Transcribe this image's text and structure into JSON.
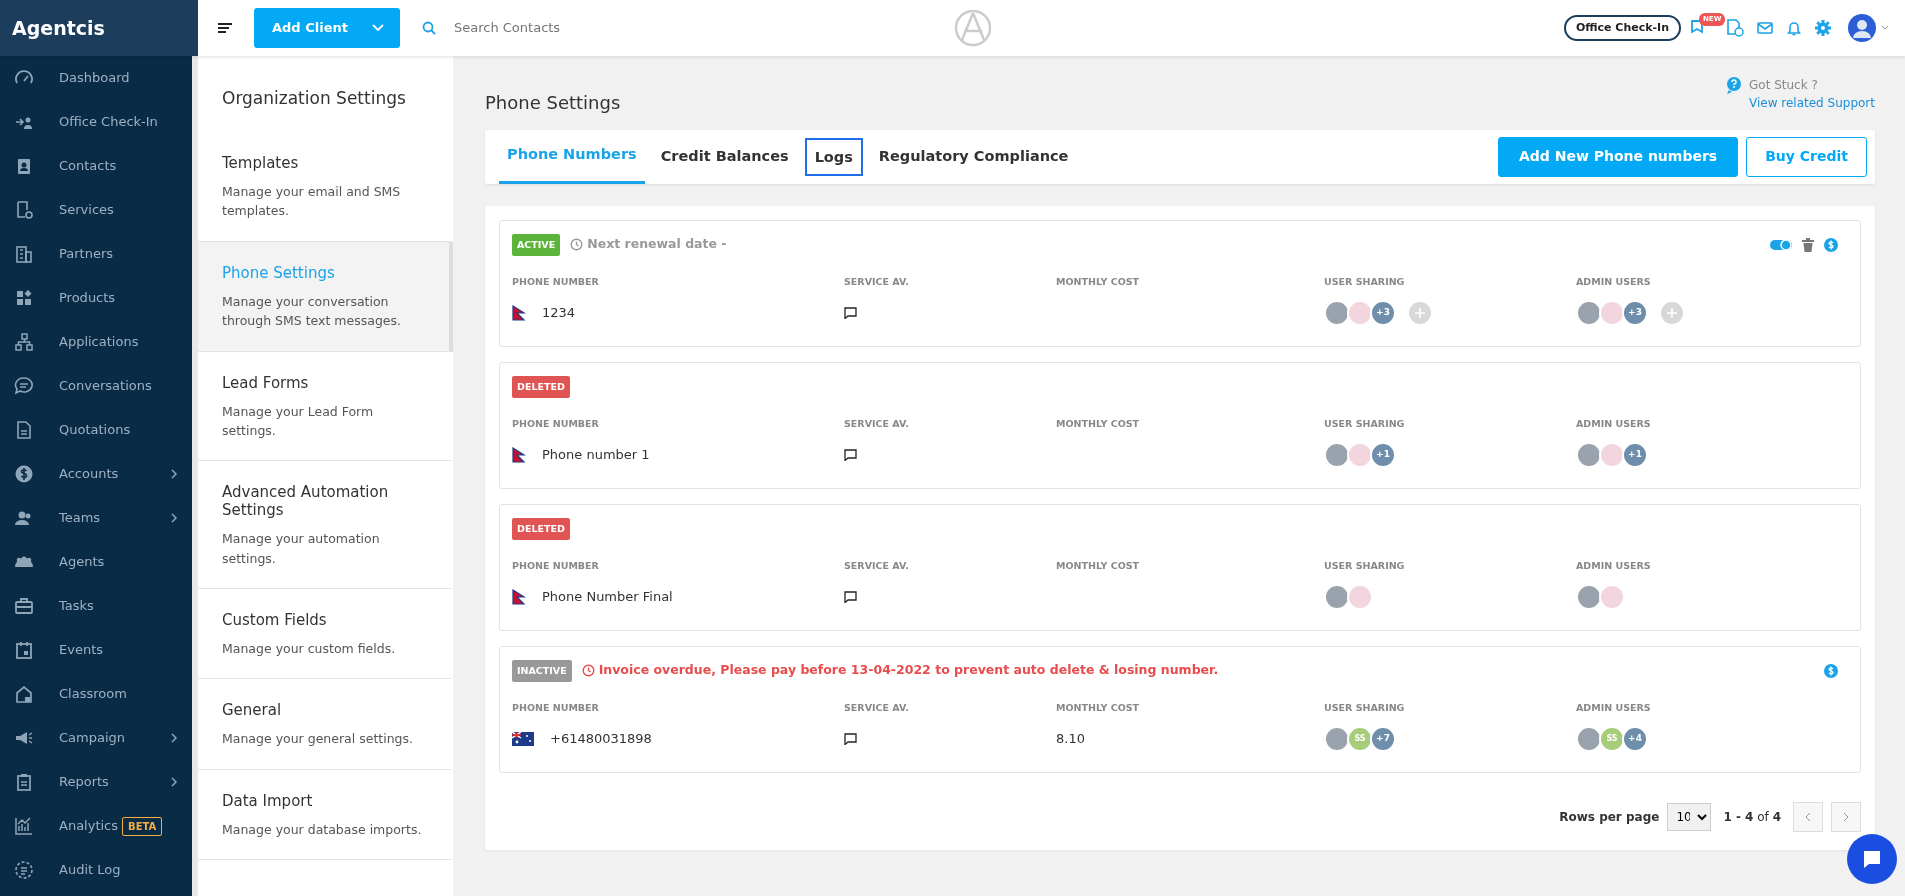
{
  "brand": "Agentcis",
  "topbar": {
    "add_client": "Add Client",
    "search": {
      "placeholder": "Search Contacts"
    },
    "office_checkin": "Office Check-In",
    "new_badge": "NEW"
  },
  "sidebar": {
    "items": [
      {
        "label": "Dashboard",
        "has_submenu": false
      },
      {
        "label": "Office Check-In",
        "has_submenu": false
      },
      {
        "label": "Contacts",
        "has_submenu": false
      },
      {
        "label": "Services",
        "has_submenu": false
      },
      {
        "label": "Partners",
        "has_submenu": false
      },
      {
        "label": "Products",
        "has_submenu": false
      },
      {
        "label": "Applications",
        "has_submenu": false
      },
      {
        "label": "Conversations",
        "has_submenu": false
      },
      {
        "label": "Quotations",
        "has_submenu": false
      },
      {
        "label": "Accounts",
        "has_submenu": true
      },
      {
        "label": "Teams",
        "has_submenu": true
      },
      {
        "label": "Agents",
        "has_submenu": false
      },
      {
        "label": "Tasks",
        "has_submenu": false
      },
      {
        "label": "Events",
        "has_submenu": false
      },
      {
        "label": "Classroom",
        "has_submenu": false
      },
      {
        "label": "Campaign",
        "has_submenu": true
      },
      {
        "label": "Reports",
        "has_submenu": true
      },
      {
        "label": "Analytics",
        "has_submenu": false,
        "badge": "BETA"
      },
      {
        "label": "Audit Log",
        "has_submenu": false
      }
    ]
  },
  "settings_panel": {
    "title": "Organization Settings",
    "items": [
      {
        "title": "Templates",
        "description": "Manage your email and SMS templates.",
        "selected": false
      },
      {
        "title": "Phone Settings",
        "description": "Manage your conversation through SMS text messages.",
        "selected": true
      },
      {
        "title": "Lead Forms",
        "description": "Manage your Lead Form settings.",
        "selected": false
      },
      {
        "title": "Advanced Automation Settings",
        "description": "Manage your automation settings.",
        "selected": false
      },
      {
        "title": "Custom Fields",
        "description": "Manage your custom fields.",
        "selected": false
      },
      {
        "title": "General",
        "description": "Manage your general settings.",
        "selected": false
      },
      {
        "title": "Data Import",
        "description": "Manage your database imports.",
        "selected": false
      }
    ]
  },
  "page": {
    "title": "Phone Settings",
    "help": {
      "title": "Got Stuck ?",
      "link": "View related Support"
    }
  },
  "tabs": [
    {
      "label": "Phone Numbers",
      "selected": true,
      "focused": false
    },
    {
      "label": "Credit Balances",
      "selected": false,
      "focused": false
    },
    {
      "label": "Logs",
      "selected": false,
      "focused": true
    },
    {
      "label": "Regulatory Compliance",
      "selected": false,
      "focused": false
    }
  ],
  "buttons": [
    {
      "label": "Add New Phone numbers",
      "kind": "primary"
    },
    {
      "label": "Buy Credit",
      "kind": "outline"
    }
  ],
  "phone_numbers": [
    {
      "status": {
        "label": "ACTIVE",
        "kind": "active"
      },
      "notice": {
        "text": "Next renewal date -",
        "kind": "info"
      },
      "actions": [
        {
          "kind": "toggle",
          "on": true
        },
        {
          "kind": "delete"
        },
        {
          "kind": "billing"
        }
      ],
      "columns": [
        "PHONE NUMBER",
        "SERVICE AV.",
        "MONTHLY COST",
        "USER SHARING",
        "ADMIN USERS"
      ],
      "flag": {
        "kind": "np"
      },
      "number": "1234",
      "user_sharing": [
        {
          "kind": "photo"
        },
        {
          "kind": "photo"
        },
        {
          "kind": "count",
          "text": "+3"
        },
        {
          "kind": "add"
        }
      ],
      "admin_users": [
        {
          "kind": "photo"
        },
        {
          "kind": "photo"
        },
        {
          "kind": "count",
          "text": "+3"
        },
        {
          "kind": "add"
        }
      ]
    },
    {
      "status": {
        "label": "DELETED",
        "kind": "deleted"
      },
      "columns": [
        "PHONE NUMBER",
        "SERVICE AV.",
        "MONTHLY COST",
        "USER SHARING",
        "ADMIN USERS"
      ],
      "flag": {
        "kind": "np"
      },
      "number": "Phone number 1",
      "user_sharing": [
        {
          "kind": "photo"
        },
        {
          "kind": "photo"
        },
        {
          "kind": "count",
          "text": "+1"
        }
      ],
      "admin_users": [
        {
          "kind": "photo"
        },
        {
          "kind": "photo"
        },
        {
          "kind": "count",
          "text": "+1"
        }
      ]
    },
    {
      "status": {
        "label": "DELETED",
        "kind": "deleted"
      },
      "columns": [
        "PHONE NUMBER",
        "SERVICE AV.",
        "MONTHLY COST",
        "USER SHARING",
        "ADMIN USERS"
      ],
      "flag": {
        "kind": "np"
      },
      "number": "Phone Number Final",
      "user_sharing": [
        {
          "kind": "photo"
        },
        {
          "kind": "photo"
        }
      ],
      "admin_users": [
        {
          "kind": "photo"
        },
        {
          "kind": "photo"
        }
      ]
    },
    {
      "status": {
        "label": "INACTIVE",
        "kind": "inactive"
      },
      "notice": {
        "text": "Invoice overdue, Please pay before 13-04-2022 to prevent auto delete & losing number.",
        "kind": "warning"
      },
      "actions": [
        {
          "kind": "billing"
        }
      ],
      "columns": [
        "PHONE NUMBER",
        "SERVICE AV.",
        "MONTHLY COST",
        "USER SHARING",
        "ADMIN USERS"
      ],
      "flag": {
        "kind": "au"
      },
      "number": "+61480031898",
      "monthly_cost": "8.10",
      "user_sharing": [
        {
          "kind": "photo"
        },
        {
          "kind": "initials",
          "text": "SS"
        },
        {
          "kind": "count",
          "text": "+7"
        }
      ],
      "admin_users": [
        {
          "kind": "photo"
        },
        {
          "kind": "initials",
          "text": "SS"
        },
        {
          "kind": "count",
          "text": "+4"
        }
      ]
    }
  ],
  "pagination": {
    "label": "Rows per page",
    "rows": "10",
    "range": "**1 - 4** of **4**"
  }
}
